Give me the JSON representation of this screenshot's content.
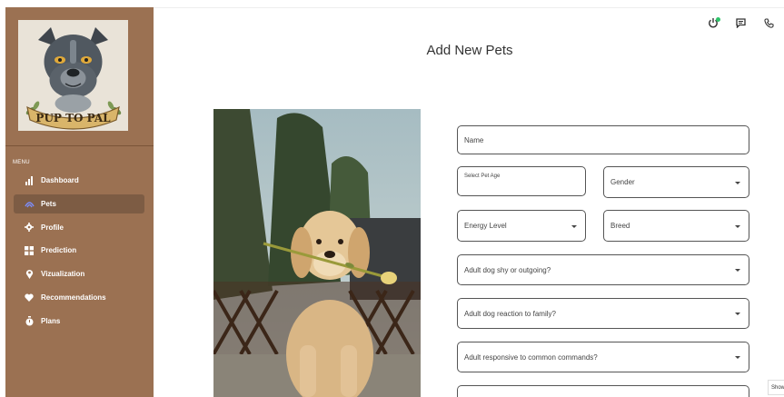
{
  "sidebar": {
    "logo_text": "PUP TO PAL",
    "menu_label": "MENU",
    "items": [
      {
        "label": "Dashboard",
        "icon": "bar-chart-icon",
        "active": false
      },
      {
        "label": "Pets",
        "icon": "paw-icon",
        "active": true
      },
      {
        "label": "Profile",
        "icon": "gear-icon",
        "active": false
      },
      {
        "label": "Prediction",
        "icon": "grid-icon",
        "active": false
      },
      {
        "label": "Vizualization",
        "icon": "map-pin-icon",
        "active": false
      },
      {
        "label": "Recommendations",
        "icon": "heart-icon",
        "active": false
      },
      {
        "label": "Plans",
        "icon": "stopwatch-icon",
        "active": false
      }
    ]
  },
  "header": {
    "icons": [
      "power-icon",
      "chat-icon",
      "phone-icon"
    ],
    "status_color": "#2ec46a"
  },
  "main": {
    "title": "Add New Pets",
    "photo_alt": "golden retriever puppy holding a flower"
  },
  "form": {
    "name_placeholder": "Name",
    "age_placeholder": "Select Pet Age",
    "gender_label": "Gender",
    "energy_label": "Energy Level",
    "breed_label": "Breed",
    "shy_label": "Adult dog shy or outgoing?",
    "family_label": "Adult dog reaction to family?",
    "commands_label": "Adult responsive to common commands?"
  },
  "footer": {
    "show_label": "Show"
  },
  "colors": {
    "sidebar_bg": "#9b7152",
    "sidebar_active": "#7d5c44",
    "active_icon": "#7c8cf5",
    "status": "#2ec46a"
  }
}
